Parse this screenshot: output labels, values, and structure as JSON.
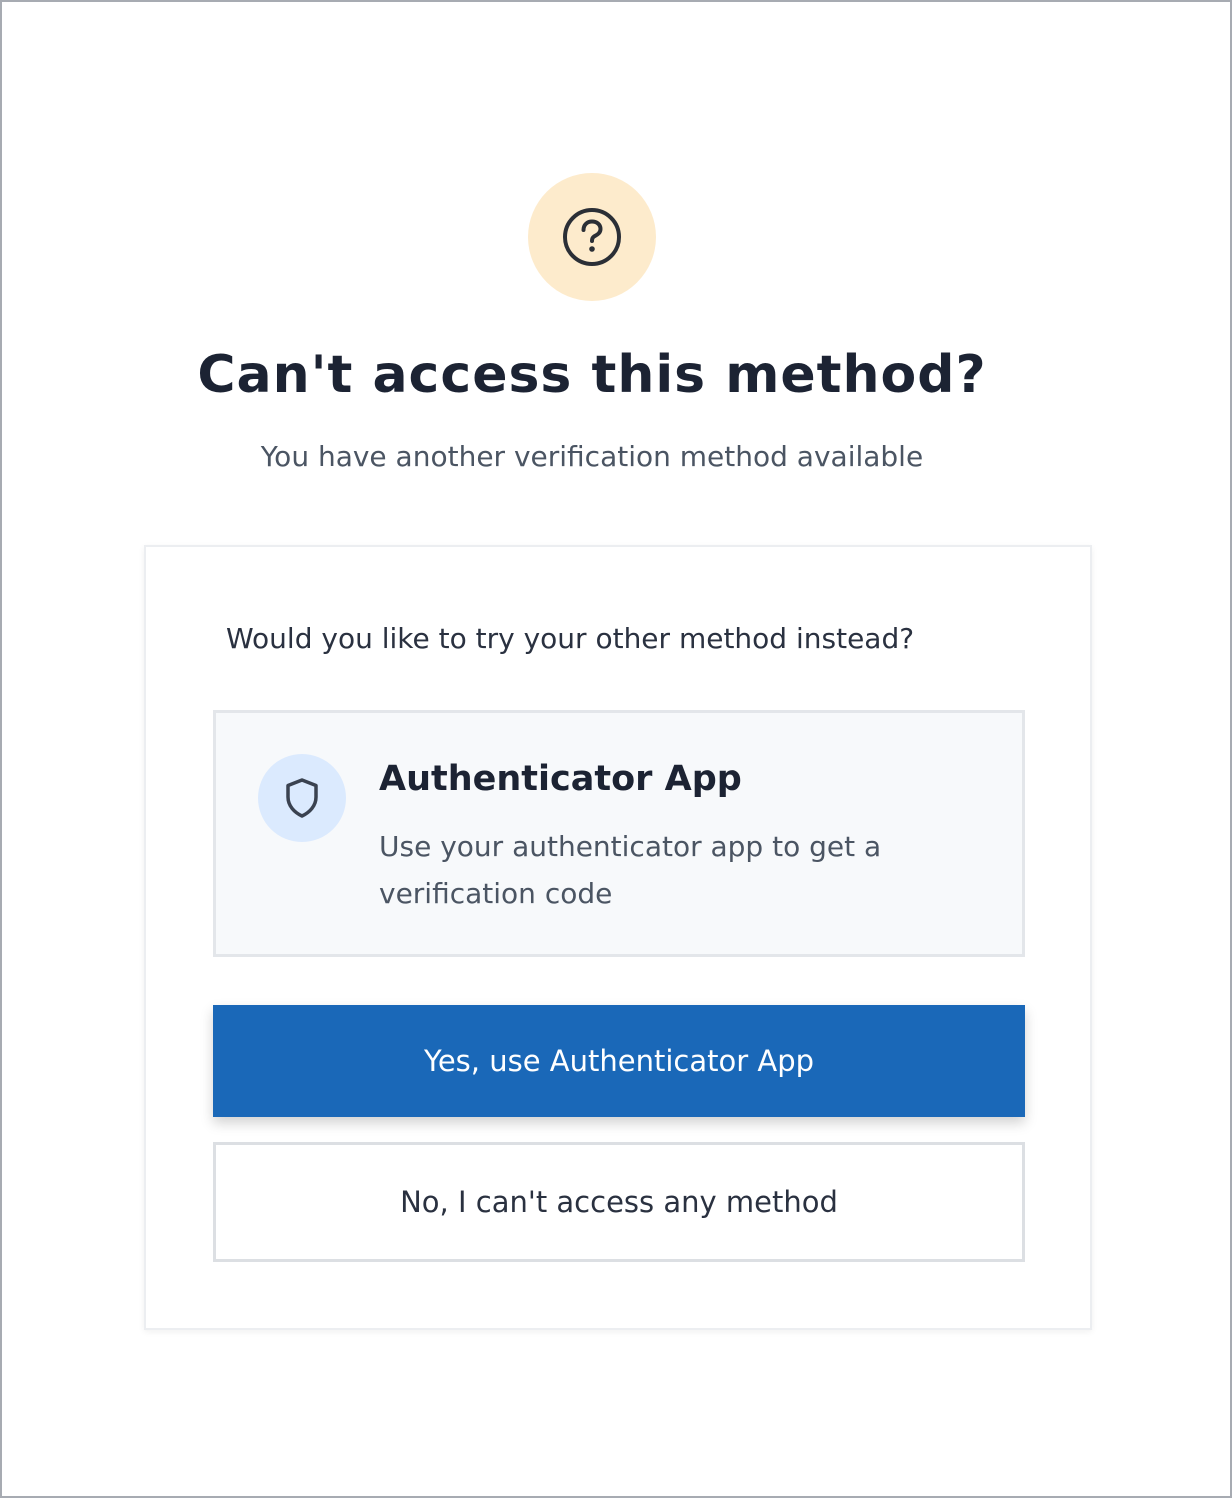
{
  "header": {
    "icon": "question-circle-icon",
    "title": "Can't access this method?",
    "subtitle": "You have another verification method available"
  },
  "card": {
    "question": "Would you like to try your other method instead?",
    "method": {
      "icon": "shield-icon",
      "title": "Authenticator App",
      "description": "Use your authenticator app to get a verification code"
    },
    "primary_button": "Yes, use Authenticator App",
    "secondary_button": "No, I can't access any method"
  },
  "colors": {
    "primary": "#1a68b8",
    "help_badge_bg": "#fdebcc",
    "method_icon_bg": "#dbeafe",
    "title_text": "#1c2333"
  }
}
